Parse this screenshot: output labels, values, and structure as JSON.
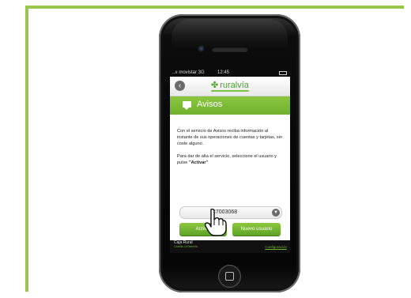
{
  "status_bar": {
    "carrier": "..ıı movistar 3G",
    "time": "12:45"
  },
  "header": {
    "brand": "ruralvía"
  },
  "section": {
    "title": "Avisos"
  },
  "body": {
    "paragraph1": "Con el servicio de Avisos reciba información al instante de sus operaciones de cuentas y tarjetas, sin coste alguno.",
    "paragraph2_prefix": "Para dar de alta el servicio, seleccione el usuario y pulse ",
    "paragraph2_bold": "\"Activar\""
  },
  "user_select": {
    "value": "C7003068"
  },
  "buttons": {
    "activar": "Activar",
    "nuevo_usuario": "Nuevo usuario"
  },
  "footer": {
    "brand_line1": "Caja Rural",
    "brand_line2": "Castilla-La Mancha",
    "config_link": "Configuración"
  },
  "colors": {
    "accent": "#8cc63f",
    "frame": "#95c84b"
  }
}
